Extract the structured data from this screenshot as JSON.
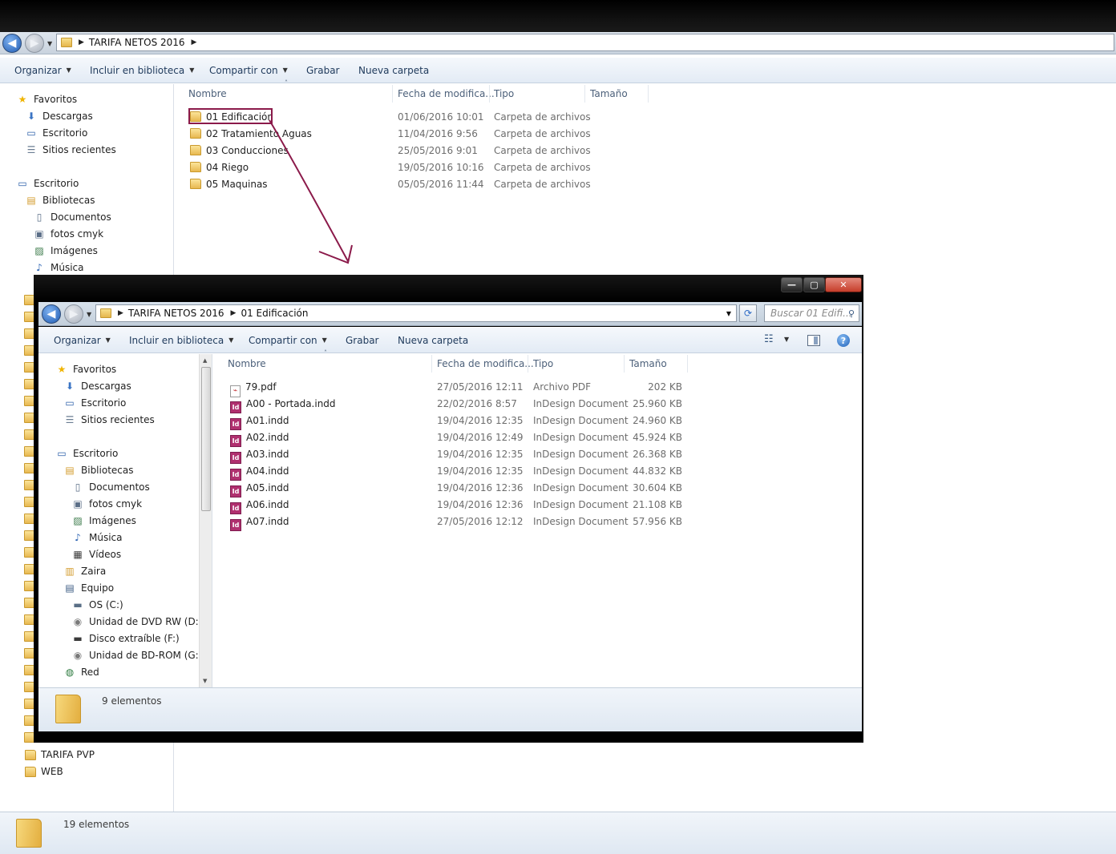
{
  "back": {
    "breadcrumb": [
      "TARIFA NETOS 2016"
    ],
    "toolbar": [
      "Organizar",
      "Incluir en biblioteca",
      "Compartir con",
      "Grabar",
      "Nueva carpeta"
    ],
    "nav_top": [
      {
        "label": "Favoritos",
        "icon": "star-icon"
      },
      {
        "label": "Descargas",
        "icon": "downloads-folder-icon"
      },
      {
        "label": "Escritorio",
        "icon": "desktop-icon"
      },
      {
        "label": "Sitios recientes",
        "icon": "recent-places-icon"
      },
      {
        "label": "Escritorio",
        "icon": "desktop-icon"
      },
      {
        "label": "Bibliotecas",
        "icon": "libraries-icon"
      },
      {
        "label": "Documentos",
        "icon": "documents-icon"
      },
      {
        "label": "fotos cmyk",
        "icon": "photos-library-icon"
      },
      {
        "label": "Imágenes",
        "icon": "pictures-icon"
      },
      {
        "label": "Música",
        "icon": "music-icon"
      }
    ],
    "nav_bottom": [
      {
        "label": "TARIFA PVP",
        "icon": "folder-icon"
      },
      {
        "label": "WEB",
        "icon": "folder-icon"
      }
    ],
    "columns": {
      "name": "Nombre",
      "date": "Fecha de modifica...",
      "type": "Tipo",
      "size": "Tamaño"
    },
    "files": [
      {
        "name": "01 Edificación",
        "date": "01/06/2016 10:01",
        "type": "Carpeta de archivos"
      },
      {
        "name": "02 Tratamiento Aguas",
        "date": "11/04/2016 9:56",
        "type": "Carpeta de archivos"
      },
      {
        "name": "03 Conducciones",
        "date": "25/05/2016 9:01",
        "type": "Carpeta de archivos"
      },
      {
        "name": "04 Riego",
        "date": "19/05/2016 10:16",
        "type": "Carpeta de archivos"
      },
      {
        "name": "05 Maquinas",
        "date": "05/05/2016 11:44",
        "type": "Carpeta de archivos"
      }
    ],
    "status": "19 elementos"
  },
  "front": {
    "breadcrumb": [
      "TARIFA NETOS 2016",
      "01 Edificación"
    ],
    "search_placeholder": "Buscar 01 Edifi...",
    "toolbar": [
      "Organizar",
      "Incluir en biblioteca",
      "Compartir con",
      "Grabar",
      "Nueva carpeta"
    ],
    "window_buttons": {
      "minimize": "—",
      "maximize": "▢",
      "close": "✕"
    },
    "help_label": "?",
    "nav": [
      {
        "label": "Favoritos",
        "icon": "star-icon",
        "indent": 0
      },
      {
        "label": "Descargas",
        "icon": "downloads-folder-icon",
        "indent": 1
      },
      {
        "label": "Escritorio",
        "icon": "desktop-icon",
        "indent": 1
      },
      {
        "label": "Sitios recientes",
        "icon": "recent-places-icon",
        "indent": 1
      },
      {
        "label": "",
        "icon": "",
        "indent": 0
      },
      {
        "label": "Escritorio",
        "icon": "desktop-icon",
        "indent": 0
      },
      {
        "label": "Bibliotecas",
        "icon": "libraries-icon",
        "indent": 1
      },
      {
        "label": "Documentos",
        "icon": "documents-icon",
        "indent": 2
      },
      {
        "label": "fotos cmyk",
        "icon": "photos-library-icon",
        "indent": 2
      },
      {
        "label": "Imágenes",
        "icon": "pictures-icon",
        "indent": 2
      },
      {
        "label": "Música",
        "icon": "music-icon",
        "indent": 2
      },
      {
        "label": "Vídeos",
        "icon": "videos-icon",
        "indent": 2
      },
      {
        "label": "Zaira",
        "icon": "user-folder-icon",
        "indent": 1
      },
      {
        "label": "Equipo",
        "icon": "computer-icon",
        "indent": 1
      },
      {
        "label": "OS (C:)",
        "icon": "hard-drive-icon",
        "indent": 2
      },
      {
        "label": "Unidad de DVD RW (D:)",
        "icon": "dvd-drive-icon",
        "indent": 2
      },
      {
        "label": "Disco extraíble (F:)",
        "icon": "removable-disk-icon",
        "indent": 2
      },
      {
        "label": "Unidad de BD-ROM (G:)",
        "icon": "bd-drive-icon",
        "indent": 2
      },
      {
        "label": "Red",
        "icon": "network-icon",
        "indent": 1
      }
    ],
    "columns": {
      "name": "Nombre",
      "date": "Fecha de modifica...",
      "type": "Tipo",
      "size": "Tamaño"
    },
    "files": [
      {
        "name": "79.pdf",
        "date": "27/05/2016 12:11",
        "type": "Archivo PDF",
        "size": "202 KB",
        "icon": "pdf"
      },
      {
        "name": "A00 - Portada.indd",
        "date": "22/02/2016 8:57",
        "type": "InDesign Document",
        "size": "25.960 KB",
        "icon": "indd"
      },
      {
        "name": "A01.indd",
        "date": "19/04/2016 12:35",
        "type": "InDesign Document",
        "size": "24.960 KB",
        "icon": "indd"
      },
      {
        "name": "A02.indd",
        "date": "19/04/2016 12:49",
        "type": "InDesign Document",
        "size": "45.924 KB",
        "icon": "indd"
      },
      {
        "name": "A03.indd",
        "date": "19/04/2016 12:35",
        "type": "InDesign Document",
        "size": "26.368 KB",
        "icon": "indd"
      },
      {
        "name": "A04.indd",
        "date": "19/04/2016 12:35",
        "type": "InDesign Document",
        "size": "44.832 KB",
        "icon": "indd"
      },
      {
        "name": "A05.indd",
        "date": "19/04/2016 12:36",
        "type": "InDesign Document",
        "size": "30.604 KB",
        "icon": "indd"
      },
      {
        "name": "A06.indd",
        "date": "19/04/2016 12:36",
        "type": "InDesign Document",
        "size": "21.108 KB",
        "icon": "indd"
      },
      {
        "name": "A07.indd",
        "date": "27/05/2016 12:12",
        "type": "InDesign Document",
        "size": "57.956 KB",
        "icon": "indd"
      }
    ],
    "status": "9 elementos"
  },
  "colors": {
    "annotation": "#8b1a4a",
    "toolbar_text": "#1e395b",
    "muted_text": "#6d6d6d"
  }
}
